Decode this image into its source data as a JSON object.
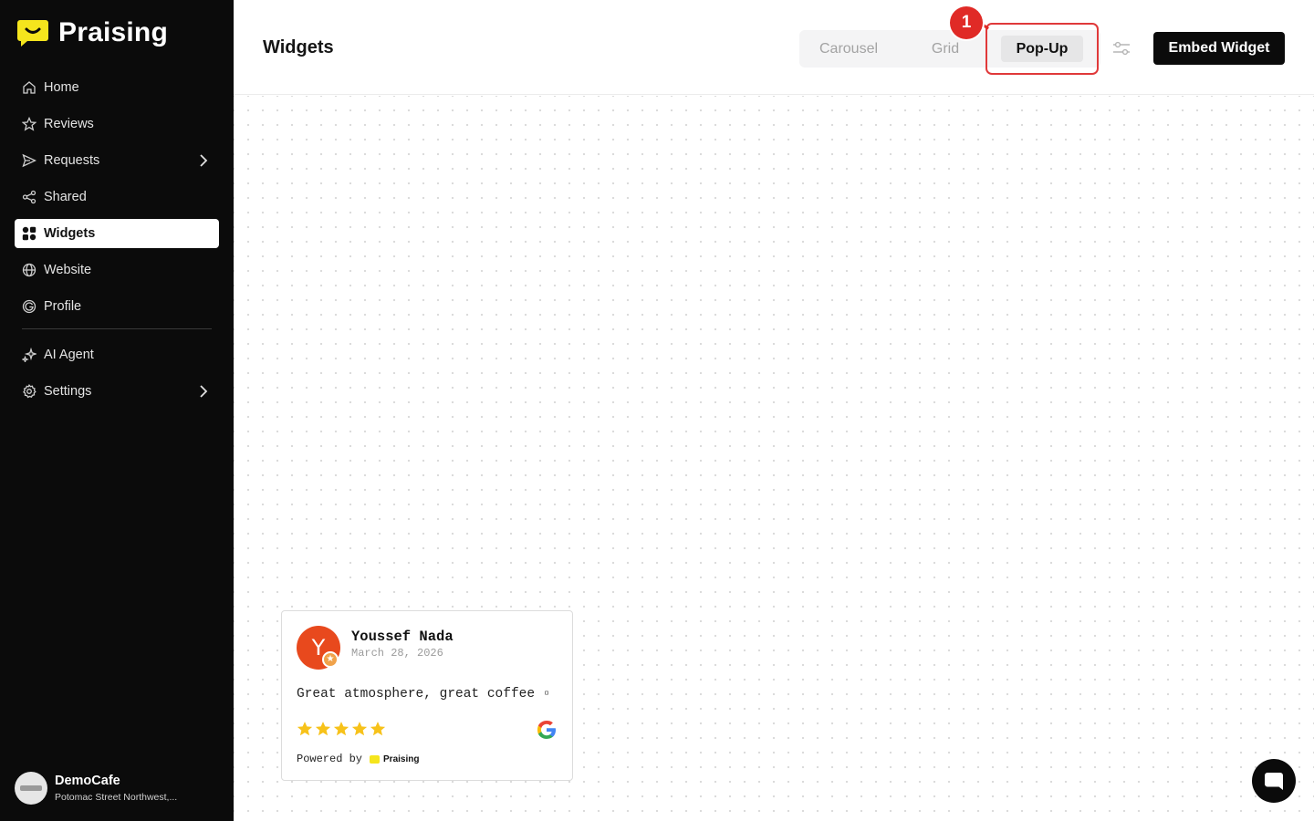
{
  "app": {
    "brand": "Praising"
  },
  "sidebar": {
    "items": [
      {
        "label": "Home",
        "icon": "home-icon"
      },
      {
        "label": "Reviews",
        "icon": "star-icon"
      },
      {
        "label": "Requests",
        "icon": "send-icon",
        "has_submenu": true
      },
      {
        "label": "Shared",
        "icon": "share-icon"
      },
      {
        "label": "Widgets",
        "icon": "widgets-icon",
        "active": true
      },
      {
        "label": "Website",
        "icon": "globe-icon"
      },
      {
        "label": "Profile",
        "icon": "google-g-icon"
      },
      {
        "label": "AI Agent",
        "icon": "sparkle-icon"
      },
      {
        "label": "Settings",
        "icon": "gear-icon",
        "has_submenu": true
      }
    ],
    "account": {
      "name": "DemoCafe",
      "address": "Potomac Street Northwest,..."
    }
  },
  "header": {
    "title": "Widgets",
    "view_tabs": [
      {
        "label": "Carousel",
        "selected": false
      },
      {
        "label": "Grid",
        "selected": false
      },
      {
        "label": "Pop-Up",
        "selected": true
      }
    ],
    "annotation_badge": "1",
    "embed_button": "Embed Widget"
  },
  "review": {
    "avatar_letter": "Y",
    "name": "Youssef Nada",
    "date": "March 28, 2026",
    "text": "Great atmosphere, great coffee ▫",
    "rating": 5,
    "source": "google-icon",
    "powered_by": "Powered by",
    "powered_brand": "Praising"
  },
  "colors": {
    "sidebar_bg": "#0b0b0b",
    "brand_yellow": "#f5e51d",
    "highlight_red": "#e0393a",
    "avatar_orange": "#e8491d",
    "star_yellow": "#f7c21a"
  }
}
